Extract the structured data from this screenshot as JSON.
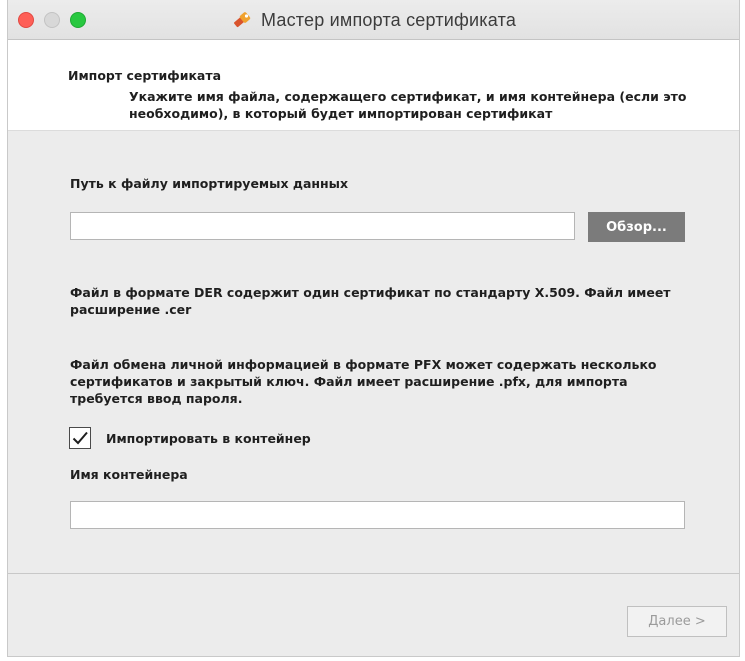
{
  "window": {
    "title": "Мастер импорта сертификата",
    "title_icon": "certificate-key-icon"
  },
  "header": {
    "title": "Импорт сертификата",
    "description": "Укажите имя файла, содержащего сертификат, и имя контейнера (если это необходимо), в который будет импортирован сертификат"
  },
  "form": {
    "file_path_label": "Путь к файлу импортируемых данных",
    "file_path_value": "",
    "browse_label": "Обзор...",
    "der_info": "Файл в формате DER содержит один сертификат по стандарту X.509. Файл имеет расширение .cer",
    "pfx_info": "Файл обмена личной информацией в формате PFX может содержать несколько сертификатов и закрытый ключ. Файл имеет расширение .pfx, для импорта требуется ввод пароля.",
    "import_to_container_label": "Импортировать в контейнер",
    "import_to_container_checked": true,
    "container_name_label": "Имя контейнера",
    "container_name_value": ""
  },
  "footer": {
    "next_label": "Далее >"
  },
  "colors": {
    "close": "#fe5f57",
    "minimize": "#d8d8d8",
    "maximize": "#28c840",
    "browse_button": "#7b7b7b"
  }
}
